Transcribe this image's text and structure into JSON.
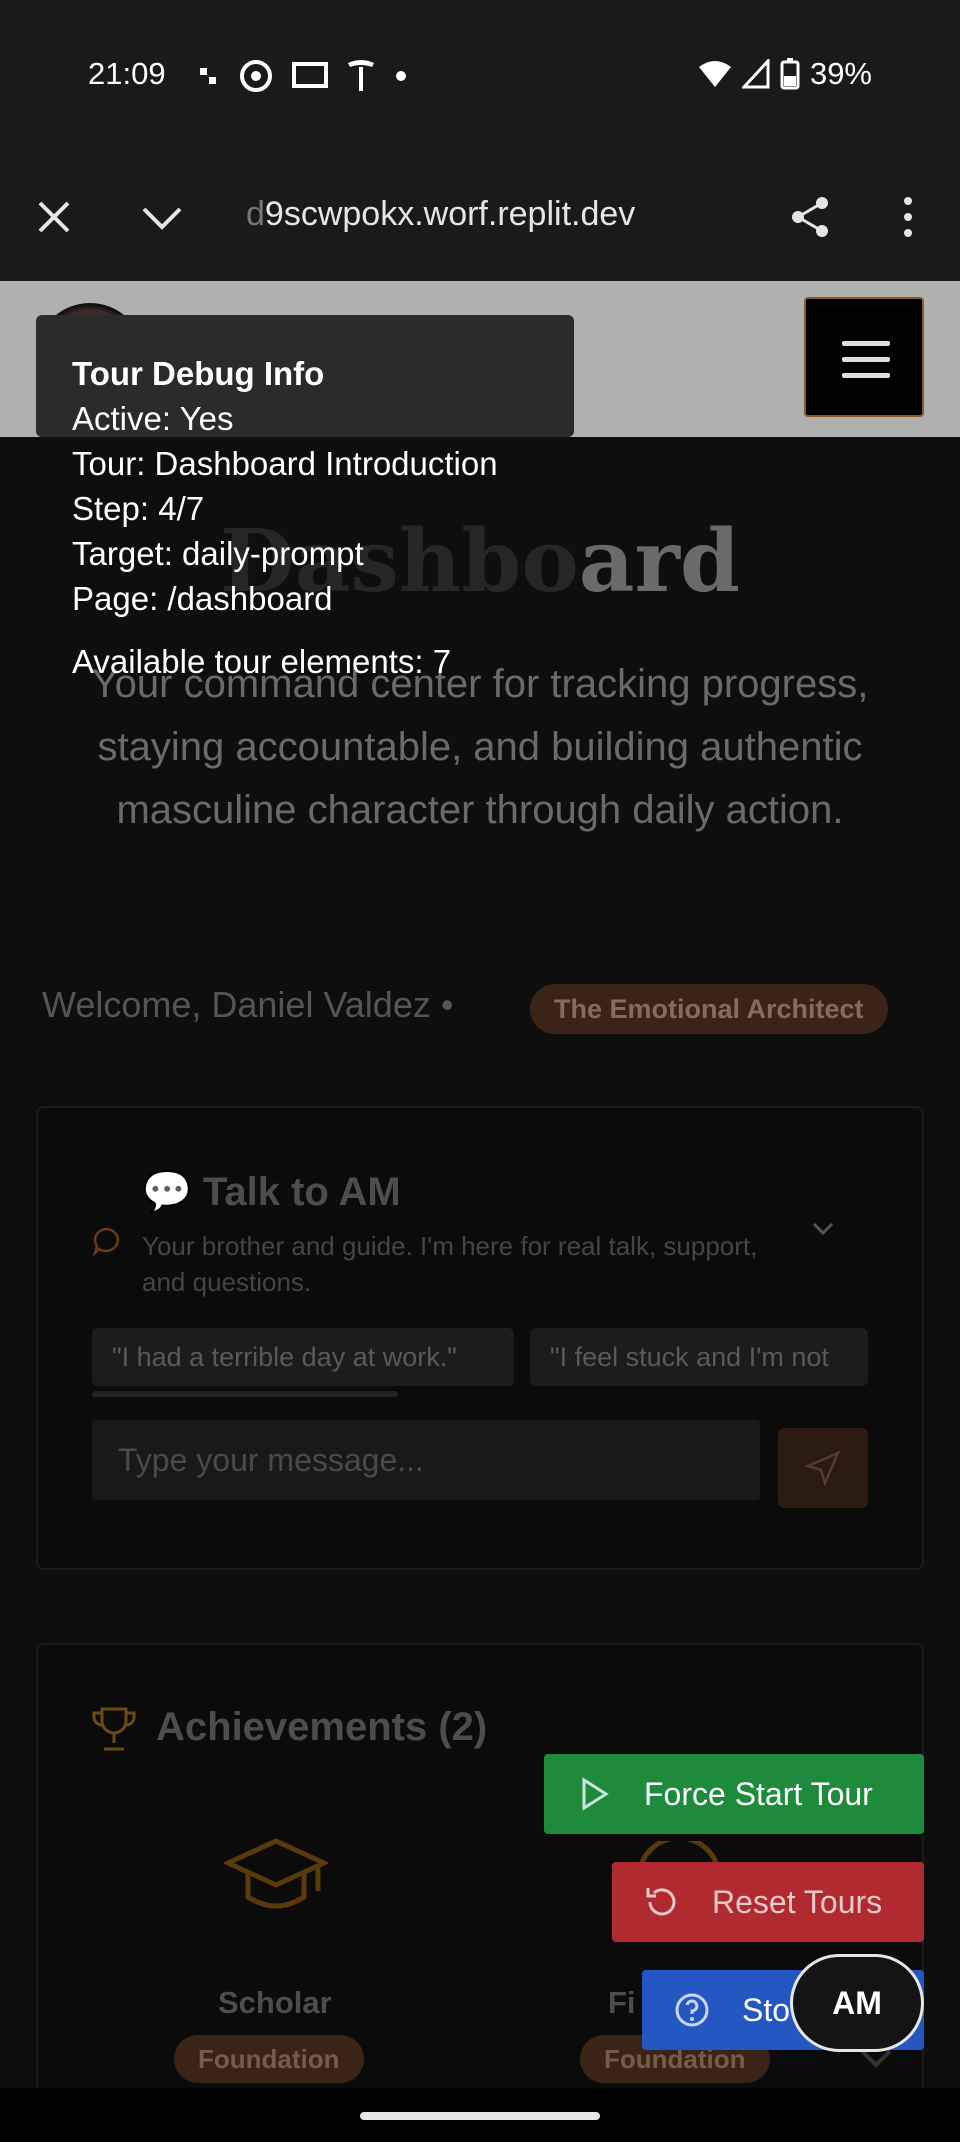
{
  "status_bar": {
    "time": "21:09",
    "battery": "39%"
  },
  "browser": {
    "url_faded": "d",
    "url": "9scwpokx.worf.replit.dev"
  },
  "debug": {
    "title": "Tour Debug Info",
    "active": "Active: Yes",
    "tour": "Tour: Dashboard Introduction",
    "step": "Step: 4/7",
    "target": "Target: daily-prompt",
    "page": "Page: /dashboard",
    "available": "Available tour elements: 7"
  },
  "hero": {
    "title_dim": "Dashbo",
    "title_bright": "ard",
    "subtitle": "Your command center for tracking progress, staying accountable, and building authentic masculine character through daily action."
  },
  "welcome": {
    "text": "Welcome, Daniel Valdez •",
    "archetype": "The Emotional Architect"
  },
  "talk": {
    "title": "💬 Talk to AM",
    "description": "Your brother and guide. I'm here for real talk, support, and questions.",
    "prompts": [
      "\"I had a terrible day at work.\"",
      "\"I feel stuck and I'm not"
    ],
    "placeholder": "Type your message..."
  },
  "achievements": {
    "title": "Achievements (2)",
    "items": [
      {
        "name": "Scholar",
        "badge": "Foundation"
      },
      {
        "name": "Fi",
        "badge": "Foundation"
      }
    ]
  },
  "tour_controls": {
    "force": "Force Start Tour",
    "reset": "Reset Tours",
    "stop": "Sto"
  },
  "am_button": "AM",
  "colors": {
    "accent": "#8a5a2a",
    "force": "#1e8a3c",
    "reset": "#b12a2f",
    "stop": "#2457c2"
  }
}
